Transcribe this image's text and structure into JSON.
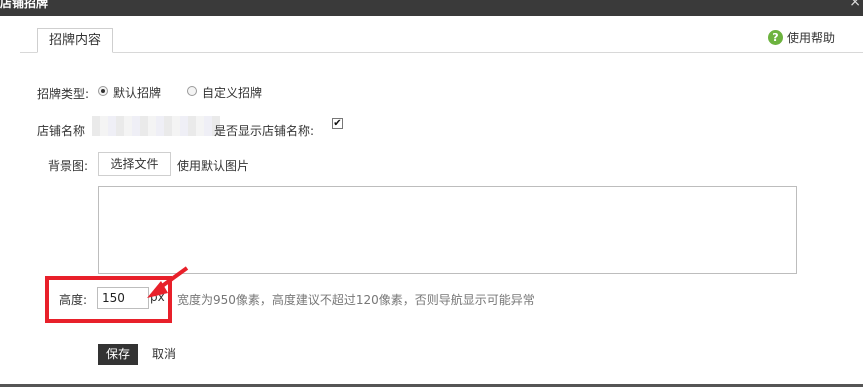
{
  "window": {
    "title": "店铺招牌",
    "close_glyph": "×"
  },
  "tabs": [
    {
      "label": "招牌内容"
    }
  ],
  "help": {
    "label": "使用帮助",
    "icon": "help-icon",
    "icon_glyph": "?"
  },
  "form": {
    "sign_type": {
      "label": "招牌类型:",
      "options": [
        {
          "label": "默认招牌",
          "checked": true
        },
        {
          "label": "自定义招牌",
          "checked": false
        }
      ]
    },
    "shop_name": {
      "label": "店铺名称",
      "show_name_label": "是否显示店铺名称:",
      "show_name_checked": true,
      "check_glyph": "✔"
    },
    "background": {
      "label": "背景图:",
      "choose_file_button": "选择文件",
      "use_default_link": "使用默认图片"
    },
    "height": {
      "label": "高度:",
      "value": "150",
      "unit": "px",
      "hint": "宽度为950像素，高度建议不超过120像素，否则导航显示可能异常"
    }
  },
  "actions": {
    "save": "保存",
    "cancel": "取消"
  },
  "colors": {
    "titlebar_bg": "#3a3a3a",
    "highlight": "#e8202a",
    "help_icon": "#6db33f",
    "save_bg": "#333333"
  }
}
